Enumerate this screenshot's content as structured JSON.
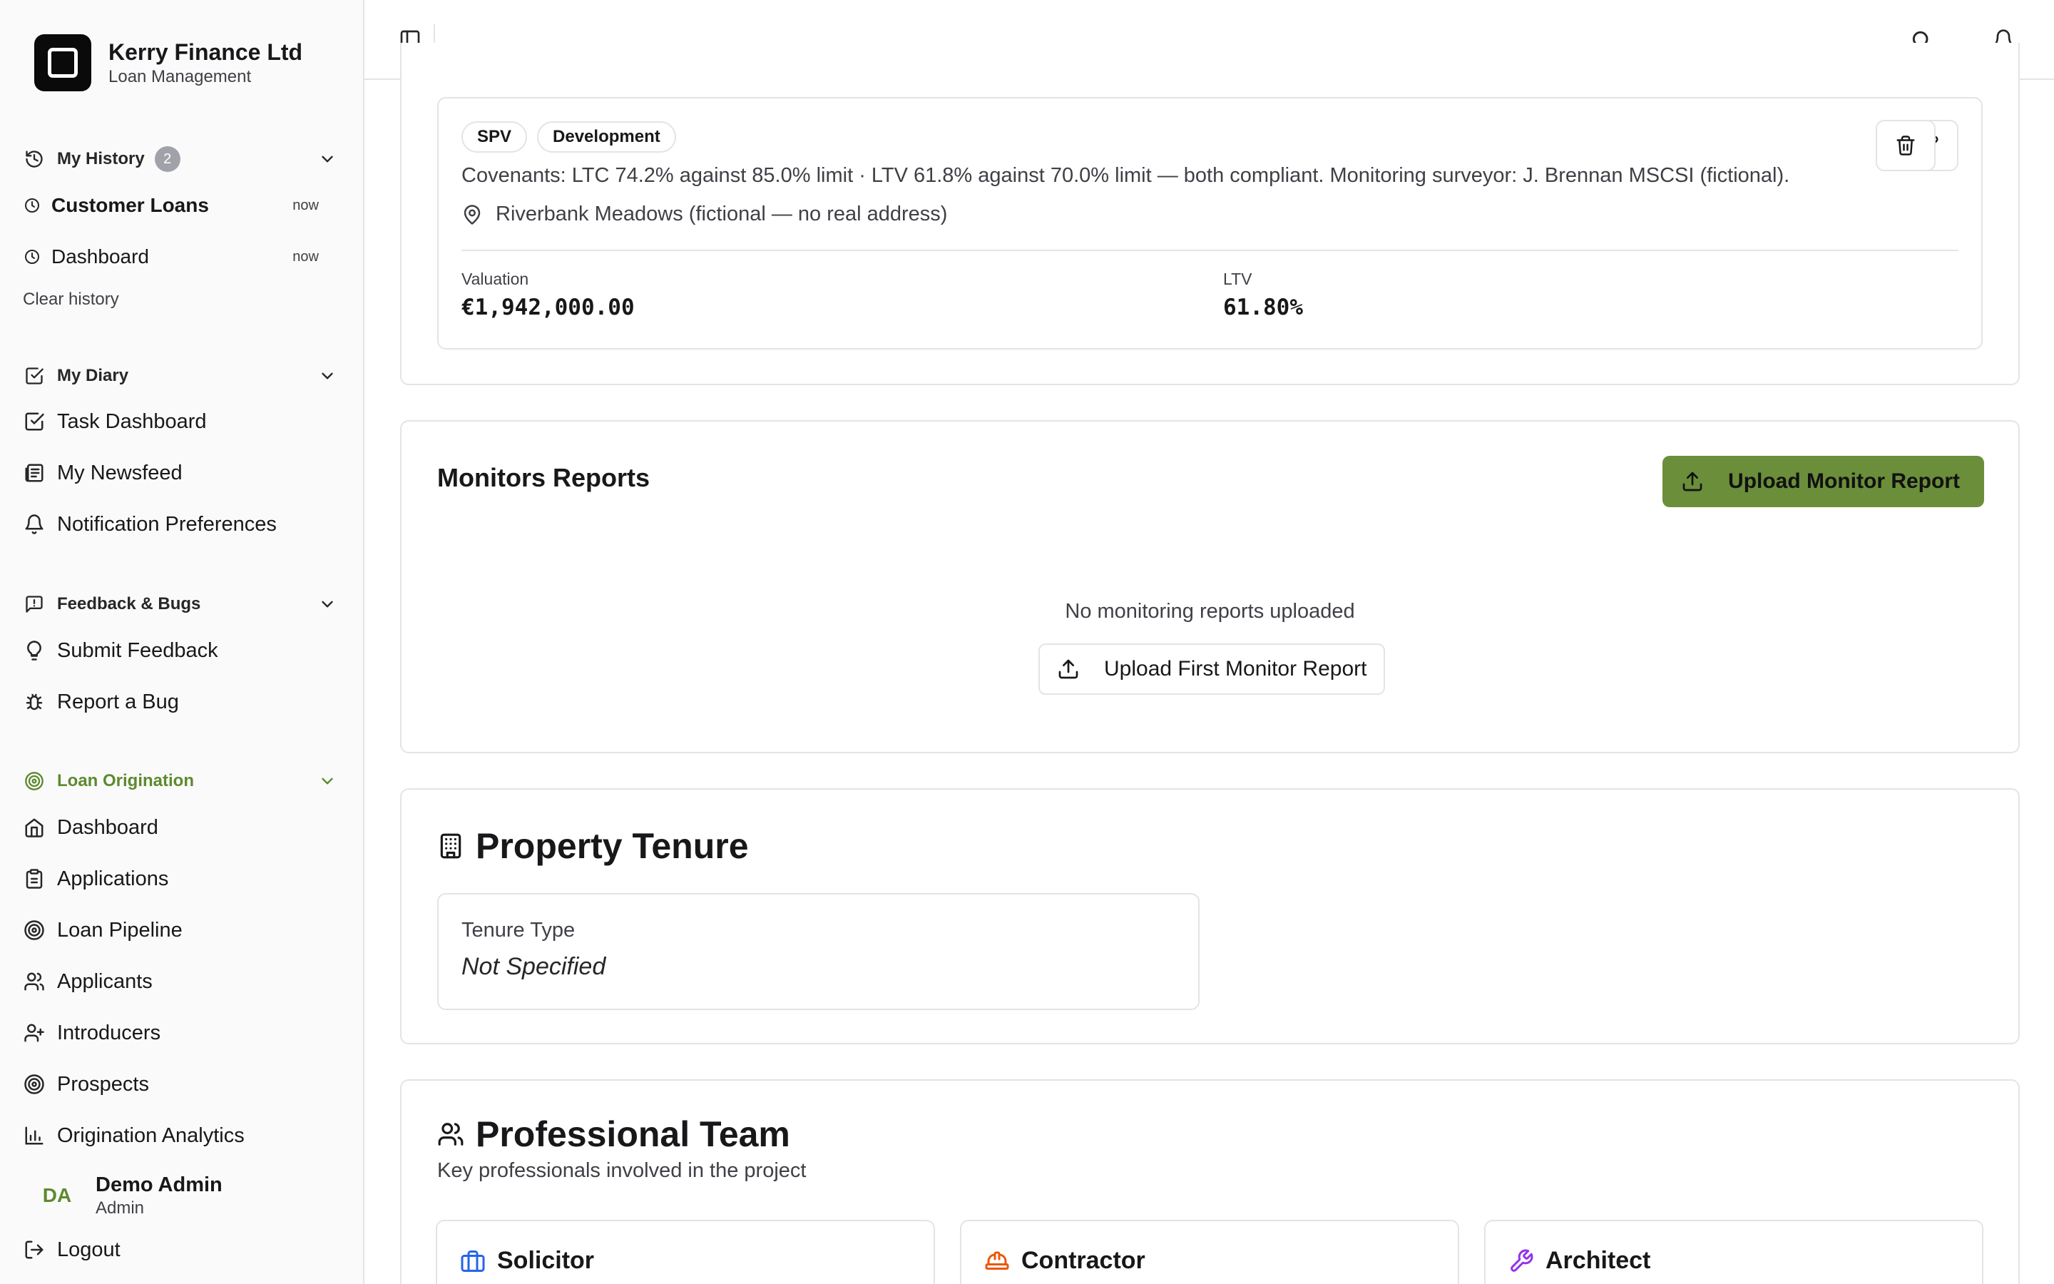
{
  "brand": {
    "name": "Kerry Finance Ltd",
    "subtitle": "Loan Management"
  },
  "history": {
    "label": "My History",
    "count": "2",
    "items": [
      {
        "label": "Customer Loans",
        "time": "now"
      },
      {
        "label": "Dashboard",
        "time": "now"
      }
    ],
    "clear_label": "Clear history"
  },
  "diary": {
    "label": "My Diary",
    "items": [
      {
        "label": "Task Dashboard",
        "icon": "check-square-icon"
      },
      {
        "label": "My Newsfeed",
        "icon": "newspaper-icon"
      },
      {
        "label": "Notification Preferences",
        "icon": "bell-icon"
      }
    ]
  },
  "feedback": {
    "label": "Feedback & Bugs",
    "items": [
      {
        "label": "Submit Feedback",
        "icon": "lightbulb-icon"
      },
      {
        "label": "Report a Bug",
        "icon": "bug-icon"
      }
    ]
  },
  "origination": {
    "label": "Loan Origination",
    "accent": "#5d8a2e",
    "items": [
      {
        "label": "Dashboard",
        "icon": "home-icon"
      },
      {
        "label": "Applications",
        "icon": "clipboard-icon"
      },
      {
        "label": "Loan Pipeline",
        "icon": "target-icon"
      },
      {
        "label": "Applicants",
        "icon": "users-icon"
      },
      {
        "label": "Introducers",
        "icon": "user-plus-icon"
      },
      {
        "label": "Prospects",
        "icon": "target-icon"
      },
      {
        "label": "Origination Analytics",
        "icon": "bar-chart-icon"
      }
    ]
  },
  "user": {
    "initials": "DA",
    "name": "Demo Admin",
    "role": "Admin"
  },
  "logout_label": "Logout",
  "security": {
    "tags": [
      "SPV",
      "Development"
    ],
    "covenants": "Covenants: LTC 74.2% against 85.0% limit · LTV 61.8% against 70.0% limit — both compliant. Monitoring surveyor: J. Brennan MSCSI (fictional).",
    "address": "Riverbank Meadows (fictional — no real address)",
    "valuation_label": "Valuation",
    "valuation_value": "€1,942,000.00",
    "ltv_label": "LTV",
    "ltv_value": "61.80%"
  },
  "monitors": {
    "title": "Monitors Reports",
    "upload_label": "Upload Monitor Report",
    "empty_text": "No monitoring reports uploaded",
    "upload_first_label": "Upload First Monitor Report",
    "button_color": "#6b8e3a"
  },
  "tenure": {
    "title": "Property Tenure",
    "type_label": "Tenure Type",
    "type_value": "Not Specified"
  },
  "team": {
    "title": "Professional Team",
    "subtitle": "Key professionals involved in the project",
    "members": [
      {
        "label": "Solicitor",
        "icon": "briefcase-icon",
        "color": "#2563eb"
      },
      {
        "label": "Contractor",
        "icon": "hard-hat-icon",
        "color": "#ea580c"
      },
      {
        "label": "Architect",
        "icon": "wrench-icon",
        "color": "#9333ea"
      }
    ]
  }
}
